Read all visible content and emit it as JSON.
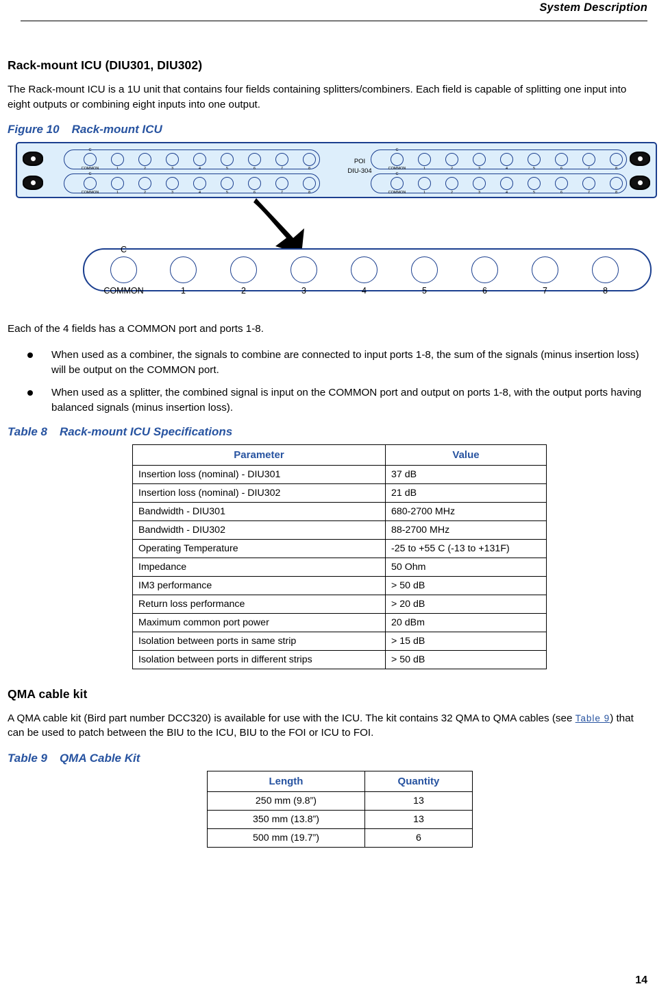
{
  "header": {
    "title": "System Description"
  },
  "page_number": "14",
  "section": {
    "heading": "Rack-mount ICU (DIU301, DIU302)",
    "intro": "The Rack-mount ICU is a 1U unit that contains four fields containing splitters/combiners. Each field is capable of splitting one input into eight outputs or combining eight inputs into one output.",
    "after_figure": "Each of the 4 fields has a COMMON port and ports 1-8.",
    "bullets": [
      "When used as a combiner, the signals to combine are connected to input ports 1-8, the sum of the signals (minus insertion loss) will be output on the COMMON port.",
      "When used as a splitter, the combined signal is input on the COMMON port and output on ports 1-8, with the output ports having balanced signals (minus insertion loss)."
    ]
  },
  "figure": {
    "label": "Figure 10",
    "title": "Rack-mount ICU",
    "poi_line1": "POI",
    "poi_line2": "DIU-304",
    "strip_common_c": "C",
    "strip_common_label": "COMMON",
    "port_labels": [
      "1",
      "2",
      "3",
      "4",
      "5",
      "6",
      "7",
      "8"
    ],
    "zoom_common_c": "C",
    "zoom_common_label": "COMMON",
    "zoom_port_labels": [
      "1",
      "2",
      "3",
      "4",
      "5",
      "6",
      "7",
      "8"
    ]
  },
  "table8": {
    "label": "Table 8",
    "title": "Rack-mount ICU Specifications",
    "headers": [
      "Parameter",
      "Value"
    ],
    "rows": [
      [
        "Insertion loss (nominal) -  DIU301",
        "37 dB"
      ],
      [
        "Insertion loss (nominal) -  DIU302",
        "21 dB"
      ],
      [
        "Bandwidth - DIU301",
        "680-2700 MHz"
      ],
      [
        "Bandwidth - DIU302",
        "88-2700 MHz"
      ],
      [
        "Operating Temperature",
        "-25 to +55 C (-13 to +131F)"
      ],
      [
        "Impedance",
        "50 Ohm"
      ],
      [
        "IM3 performance",
        "> 50 dB"
      ],
      [
        "Return loss performance",
        "> 20 dB"
      ],
      [
        "Maximum common port power",
        "20 dBm"
      ],
      [
        "Isolation between ports in same strip",
        "> 15 dB"
      ],
      [
        "Isolation between ports in different strips",
        "> 50 dB"
      ]
    ]
  },
  "qma": {
    "heading": "QMA cable kit",
    "text_before_link": "A QMA cable kit (Bird part number DCC320) is available for use with the ICU. The kit contains 32 QMA to QMA cables (see ",
    "link_text": "Table 9",
    "text_after_link": ") that can be used to patch between the BIU to the ICU, BIU to the FOI or ICU to FOI."
  },
  "table9": {
    "label": "Table 9",
    "title": "QMA Cable Kit",
    "headers": [
      "Length",
      "Quantity"
    ],
    "rows": [
      [
        "250 mm (9.8”)",
        "13"
      ],
      [
        "350 mm (13.8”)",
        "13"
      ],
      [
        "500 mm (19.7”)",
        "6"
      ]
    ]
  }
}
